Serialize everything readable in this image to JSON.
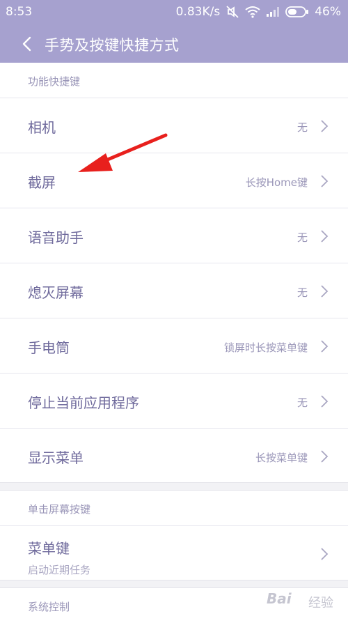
{
  "status_bar": {
    "time": "8:53",
    "network_speed": "0.83K/s",
    "battery": "46%"
  },
  "app_bar": {
    "title": "手势及按键快捷方式"
  },
  "sections": [
    {
      "header": "功能快捷键",
      "rows": [
        {
          "label": "相机",
          "value": "无"
        },
        {
          "label": "截屏",
          "value": "长按Home键"
        },
        {
          "label": "语音助手",
          "value": "无"
        },
        {
          "label": "熄灭屏幕",
          "value": "无"
        },
        {
          "label": "手电筒",
          "value": "锁屏时长按菜单键"
        },
        {
          "label": "停止当前应用程序",
          "value": "无"
        },
        {
          "label": "显示菜单",
          "value": "长按菜单键"
        }
      ]
    },
    {
      "header": "单击屏幕按键",
      "rows": [
        {
          "label": "菜单键",
          "subtitle": "启动近期任务"
        }
      ]
    },
    {
      "header": "系统控制"
    }
  ],
  "watermark": {
    "logo": "Bai",
    "text": "经验"
  },
  "colors": {
    "accent": "#a6a1cf",
    "label": "#6f6a9c",
    "secondary": "#9a96b8",
    "arrow": "#e8201d"
  }
}
